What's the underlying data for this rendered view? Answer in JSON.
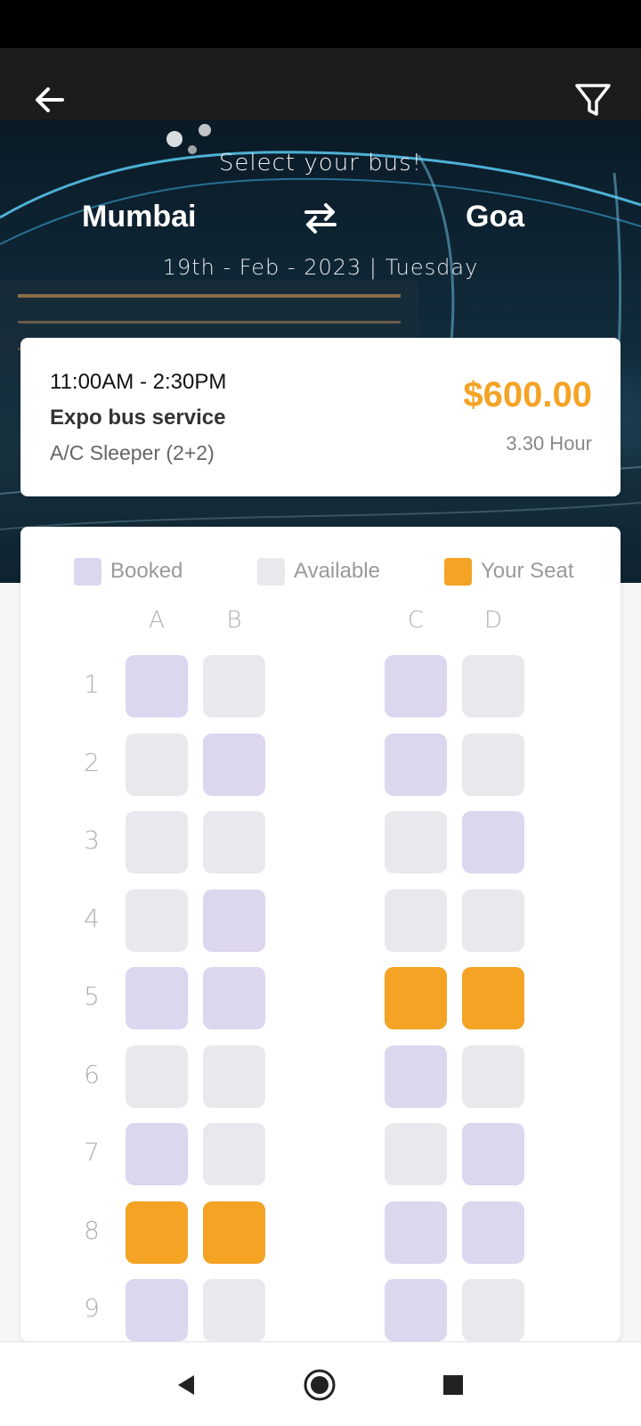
{
  "header": {
    "back_icon": "arrow-left-icon",
    "filter_icon": "filter-funnel-icon",
    "title": "Select your bus!",
    "from": "Mumbai",
    "to": "Goa",
    "swap_icon": "swap-arrows-icon",
    "date": "19th - Feb - 2023 | Tuesday"
  },
  "bus": {
    "time": "11:00AM - 2:30PM",
    "name": "Expo bus service",
    "type": "A/C Sleeper (2+2)",
    "price": "$600.00",
    "duration": "3.30 Hour"
  },
  "legend": {
    "booked": "Booked",
    "available": "Available",
    "yours": "Your Seat"
  },
  "colors": {
    "accent": "#f4a325",
    "booked": "#ddd6ef",
    "available": "#e9e9ed"
  },
  "seat_map": {
    "columns": [
      "A",
      "B",
      "C",
      "D"
    ],
    "rows": [
      {
        "number": "1",
        "seats": [
          "booked",
          "available",
          "booked",
          "available"
        ]
      },
      {
        "number": "2",
        "seats": [
          "available",
          "booked",
          "booked",
          "available"
        ]
      },
      {
        "number": "3",
        "seats": [
          "available",
          "available",
          "available",
          "booked"
        ]
      },
      {
        "number": "4",
        "seats": [
          "available",
          "booked",
          "available",
          "available"
        ]
      },
      {
        "number": "5",
        "seats": [
          "booked",
          "booked",
          "yours",
          "yours"
        ]
      },
      {
        "number": "6",
        "seats": [
          "available",
          "available",
          "booked",
          "available"
        ]
      },
      {
        "number": "7",
        "seats": [
          "booked",
          "available",
          "available",
          "booked"
        ]
      },
      {
        "number": "8",
        "seats": [
          "yours",
          "yours",
          "booked",
          "booked"
        ]
      },
      {
        "number": "9",
        "seats": [
          "booked",
          "available",
          "booked",
          "available"
        ]
      }
    ]
  },
  "nav": {
    "back_icon": "triangle-back-icon",
    "home_icon": "circle-home-icon",
    "recents_icon": "square-recents-icon"
  }
}
